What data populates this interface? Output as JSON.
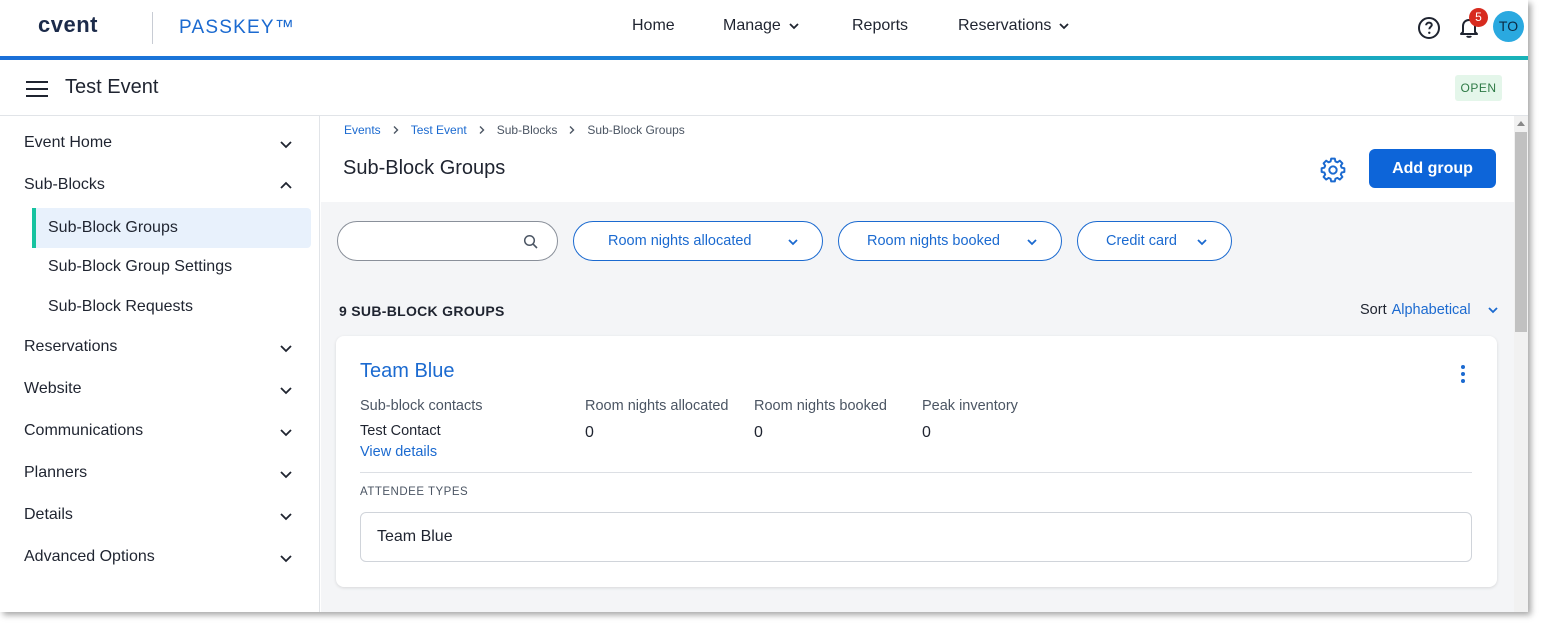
{
  "brand": {
    "logo": "cvent",
    "product": "PASSKEY™"
  },
  "topnav": {
    "items": [
      {
        "label": "Home",
        "dropdown": false
      },
      {
        "label": "Manage",
        "dropdown": true
      },
      {
        "label": "Reports",
        "dropdown": false
      },
      {
        "label": "Reservations",
        "dropdown": true
      }
    ],
    "notifications_count": "5",
    "avatar_initials": "TO",
    "icons": [
      "help-icon",
      "bell-icon"
    ]
  },
  "event": {
    "title": "Test Event",
    "status": "OPEN"
  },
  "sidebar": {
    "items": [
      {
        "label": "Event Home",
        "expanded": false
      },
      {
        "label": "Sub-Blocks",
        "expanded": true
      },
      {
        "label": "Reservations",
        "expanded": false
      },
      {
        "label": "Website",
        "expanded": false
      },
      {
        "label": "Communications",
        "expanded": false
      },
      {
        "label": "Planners",
        "expanded": false
      },
      {
        "label": "Details",
        "expanded": false
      },
      {
        "label": "Advanced Options",
        "expanded": false
      }
    ],
    "subitems": [
      {
        "label": "Sub-Block Groups",
        "active": true
      },
      {
        "label": "Sub-Block Group Settings",
        "active": false
      },
      {
        "label": "Sub-Block Requests",
        "active": false
      }
    ]
  },
  "breadcrumb": [
    "Events",
    "Test Event",
    "Sub-Blocks",
    "Sub-Block Groups"
  ],
  "page": {
    "title": "Sub-Block Groups",
    "add_button": "Add group"
  },
  "search": {
    "placeholder": "",
    "value": ""
  },
  "filters": [
    "Room nights allocated",
    "Room nights booked",
    "Credit card"
  ],
  "list": {
    "count_label": "9 SUB-BLOCK GROUPS",
    "sort_label": "Sort",
    "sort_value": "Alphabetical"
  },
  "card": {
    "title": "Team Blue",
    "fields": {
      "contacts_label": "Sub-block contacts",
      "contact_name": "Test Contact",
      "view_details": "View details",
      "allocated_label": "Room nights allocated",
      "allocated_value": "0",
      "booked_label": "Room nights booked",
      "booked_value": "0",
      "peak_label": "Peak inventory",
      "peak_value": "0"
    },
    "attendee_types_label": "ATTENDEE TYPES",
    "attendee_types": [
      "Team Blue"
    ]
  },
  "colors": {
    "accent": "#0d65d9",
    "link": "#1b6ad0",
    "active_marker": "#17c3a0",
    "status_bg": "#e4f6ea",
    "badge": "#d72b1f"
  }
}
